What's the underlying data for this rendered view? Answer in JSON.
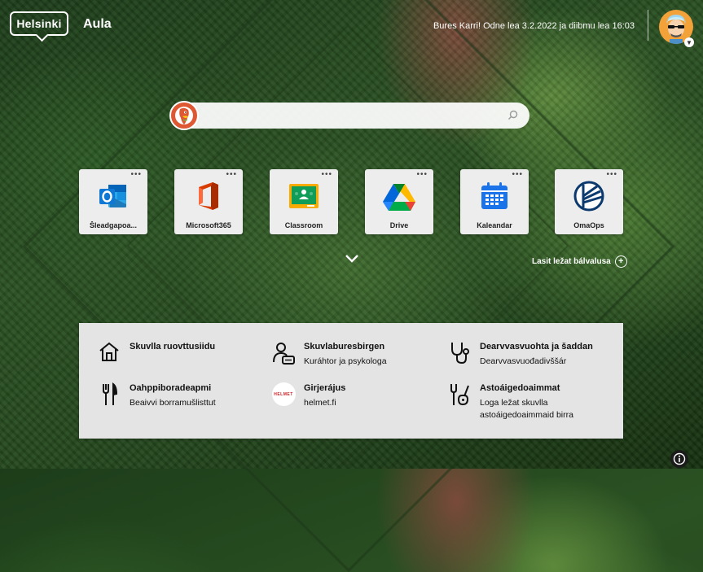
{
  "header": {
    "logo_text": "Helsinki",
    "app_name": "Aula",
    "greeting": "Bures Karri! Odne lea 3.2.2022 ja diibmu lea 16:03"
  },
  "search": {
    "placeholder": ""
  },
  "tiles": [
    {
      "label": "Šleadgapoa...",
      "icon": "outlook-icon"
    },
    {
      "label": "Microsoft365",
      "icon": "office-icon"
    },
    {
      "label": "Classroom",
      "icon": "classroom-icon"
    },
    {
      "label": "Drive",
      "icon": "drive-icon"
    },
    {
      "label": "Kaleandar",
      "icon": "calendar-icon"
    },
    {
      "label": "OmaOps",
      "icon": "omaops-icon"
    }
  ],
  "tile_more": "•••",
  "add_link": {
    "label": "Lasit ležat bálvalusa"
  },
  "links": [
    {
      "title": "Skuvlla ruovttusiidu",
      "subtitle": "",
      "icon": "home-icon"
    },
    {
      "title": "Skuvlaburesbirgen",
      "subtitle": "Kuráhtor ja psykologa",
      "icon": "person-support-icon"
    },
    {
      "title": "Dearvvasvuohta ja šaddan",
      "subtitle": "Dearvvasvuođadivššár",
      "icon": "stethoscope-icon"
    },
    {
      "title": "Oahppiboradeapmi",
      "subtitle": "Beaivvi borramušlisttut",
      "icon": "fork-knife-icon"
    },
    {
      "title": "Girjerájus",
      "subtitle": "helmet.fi",
      "icon": "helmet-logo"
    },
    {
      "title": "Astoáigedoaimmat",
      "subtitle_lines": [
        "Loga ležat skuvlla",
        "astoáigedoaimmaid birra"
      ],
      "icon": "music-activity-icon"
    }
  ],
  "helmet_badge_text": "HELMET",
  "colors": {
    "panel_bg": "#e4e4e4",
    "tile_bg": "#ededed",
    "duckduckgo": "#de5833",
    "avatar_bg": "#f3a23a"
  }
}
